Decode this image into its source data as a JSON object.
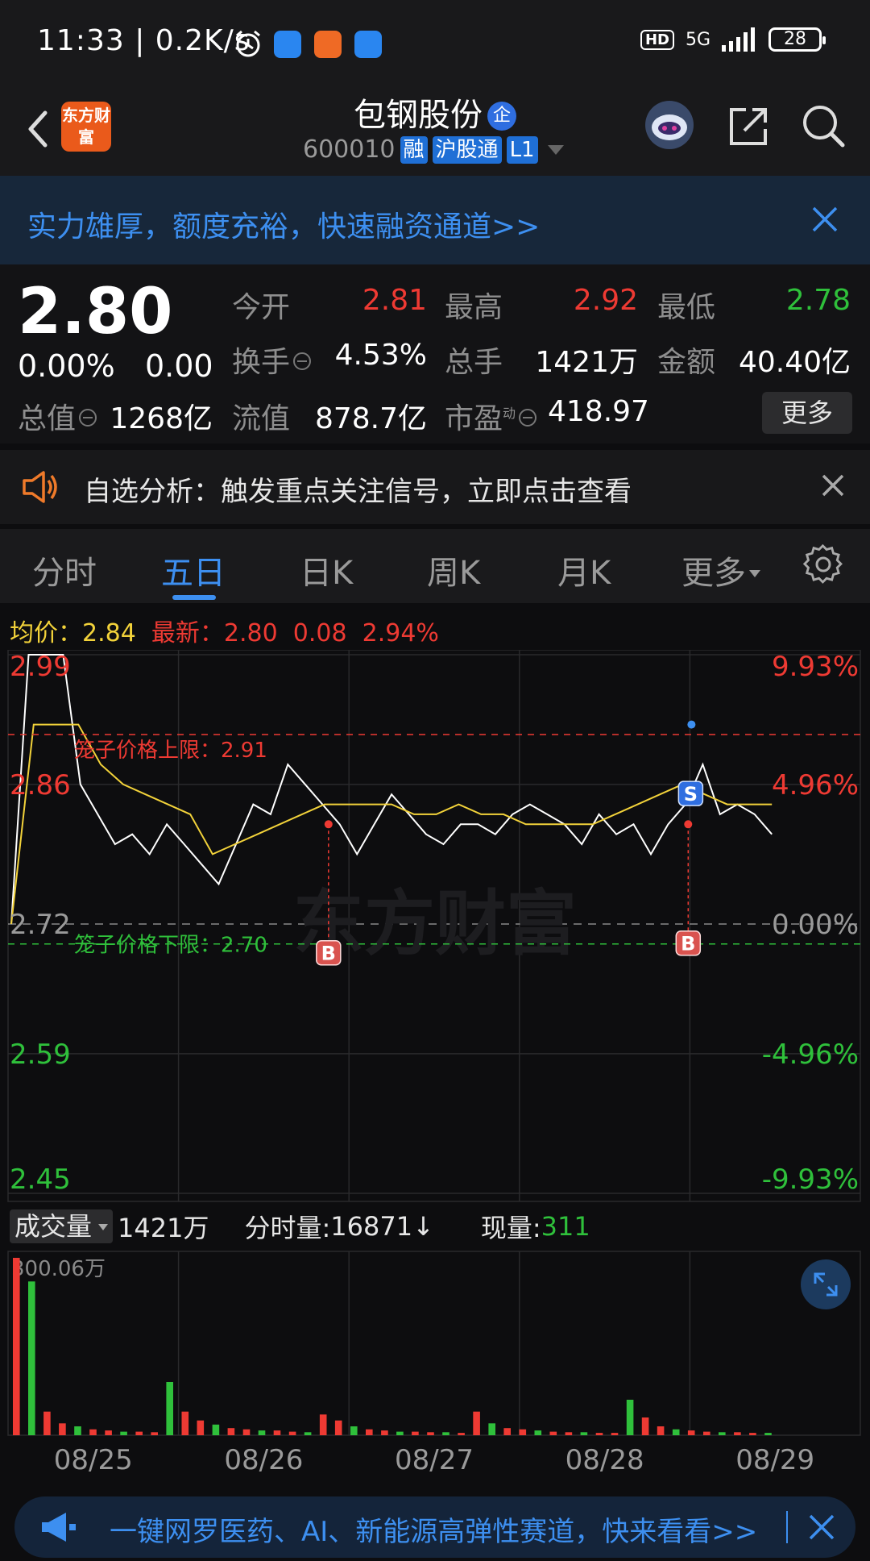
{
  "status": {
    "time": "11:33 | 0.2K/s",
    "network": "5G",
    "hd": "HD",
    "battery": "28"
  },
  "header": {
    "logo": "东方财富",
    "stock_name": "包钢股份",
    "name_badge": "企",
    "stock_code": "600010",
    "tags": [
      "融",
      "沪股通",
      "L1"
    ]
  },
  "promo": {
    "text": "实力雄厚，额度充裕，快速融资通道>>"
  },
  "quote": {
    "price": "2.80",
    "change_pct": "0.00%",
    "change_abs": "0.00",
    "cells": [
      {
        "label": "今开",
        "value": "2.81",
        "color": "red"
      },
      {
        "label": "最高",
        "value": "2.92",
        "color": "red"
      },
      {
        "label": "最低",
        "value": "2.78",
        "color": "green"
      },
      {
        "label": "换手",
        "value": "4.53%",
        "color": "white"
      },
      {
        "label": "总手",
        "value": "1421万",
        "color": "white"
      },
      {
        "label": "金额",
        "value": "40.40亿",
        "color": "white"
      },
      {
        "label": "总值",
        "value": "1268亿",
        "color": "white"
      },
      {
        "label": "流值",
        "value": "878.7亿",
        "color": "white"
      },
      {
        "label": "市盈",
        "value": "418.97",
        "color": "white"
      }
    ],
    "pe_superscript": "动",
    "more": "更多"
  },
  "notice": {
    "text": "自选分析：触发重点关注信号，立即点击查看"
  },
  "tabs": [
    "分时",
    "五日",
    "日K",
    "周K",
    "月K",
    "更多"
  ],
  "active_tab": "五日",
  "chart_info": {
    "avg_label": "均价：",
    "avg_value": "2.84",
    "latest_label": "最新：",
    "latest_value": "2.80",
    "change": "0.08",
    "change_pct": "2.94%"
  },
  "chart_data": [
    {
      "type": "line",
      "x": [
        "08/25",
        "08/26",
        "08/27",
        "08/28",
        "08/29"
      ],
      "y_ticks_left": [
        "2.99",
        "2.86",
        "2.72",
        "2.59",
        "2.45"
      ],
      "y_ticks_right": [
        "9.93%",
        "4.96%",
        "0.00%",
        "-4.96%",
        "-9.93%"
      ],
      "ylim": [
        2.45,
        2.99
      ],
      "reference_price": 2.72,
      "annotations": [
        {
          "text": "笼子价格上限：2.91",
          "value": 2.91,
          "color": "#ee3a33"
        },
        {
          "text": "笼子价格下限：2.70",
          "value": 2.7,
          "color": "#2fc03b"
        }
      ],
      "markers": [
        {
          "label": "B",
          "day": "08/26"
        },
        {
          "label": "B",
          "day": "08/28"
        },
        {
          "label": "S",
          "day": "08/28"
        }
      ],
      "series": [
        {
          "color": "#ffffff",
          "values": [
            2.72,
            2.99,
            2.99,
            2.99,
            2.86,
            2.83,
            2.8,
            2.81,
            2.79,
            2.82,
            2.8,
            2.78,
            2.76,
            2.8,
            2.84,
            2.83,
            2.88,
            2.86,
            2.84,
            2.82,
            2.79,
            2.82,
            2.85,
            2.83,
            2.81,
            2.8,
            2.82,
            2.82,
            2.81,
            2.83,
            2.84,
            2.83,
            2.82,
            2.8,
            2.83,
            2.81,
            2.82,
            2.79,
            2.82,
            2.84,
            2.88,
            2.83,
            2.84,
            2.83,
            2.81
          ]
        },
        {
          "color": "#f2d23a",
          "values": [
            2.72,
            2.92,
            2.92,
            2.92,
            2.88,
            2.86,
            2.85,
            2.84,
            2.83,
            2.79,
            2.8,
            2.81,
            2.82,
            2.83,
            2.84,
            2.84,
            2.84,
            2.84,
            2.83,
            2.83,
            2.84,
            2.83,
            2.83,
            2.82,
            2.82,
            2.82,
            2.82,
            2.83,
            2.84,
            2.85,
            2.86,
            2.85,
            2.84,
            2.84,
            2.84
          ]
        }
      ]
    },
    {
      "type": "bar",
      "x": [
        "08/25",
        "08/26",
        "08/27",
        "08/28",
        "08/29"
      ],
      "ymax_label": "300.06万",
      "values": [
        300,
        260,
        40,
        20,
        15,
        10,
        8,
        6,
        6,
        5,
        90,
        40,
        25,
        18,
        12,
        10,
        8,
        8,
        6,
        5,
        35,
        25,
        15,
        10,
        8,
        6,
        6,
        5,
        5,
        4,
        40,
        20,
        12,
        10,
        8,
        6,
        5,
        5,
        4,
        4,
        60,
        30,
        15,
        10,
        8,
        6,
        5,
        5,
        4,
        4
      ]
    }
  ],
  "volume": {
    "dropdown": "成交量",
    "total": "1421万",
    "tick_label": "分时量:",
    "tick_value": "16871↓",
    "current_label": "现量:",
    "current_value": "311"
  },
  "bottom": {
    "text": "一键网罗医药、AI、新能源高弹性赛道，快来看看>>"
  }
}
